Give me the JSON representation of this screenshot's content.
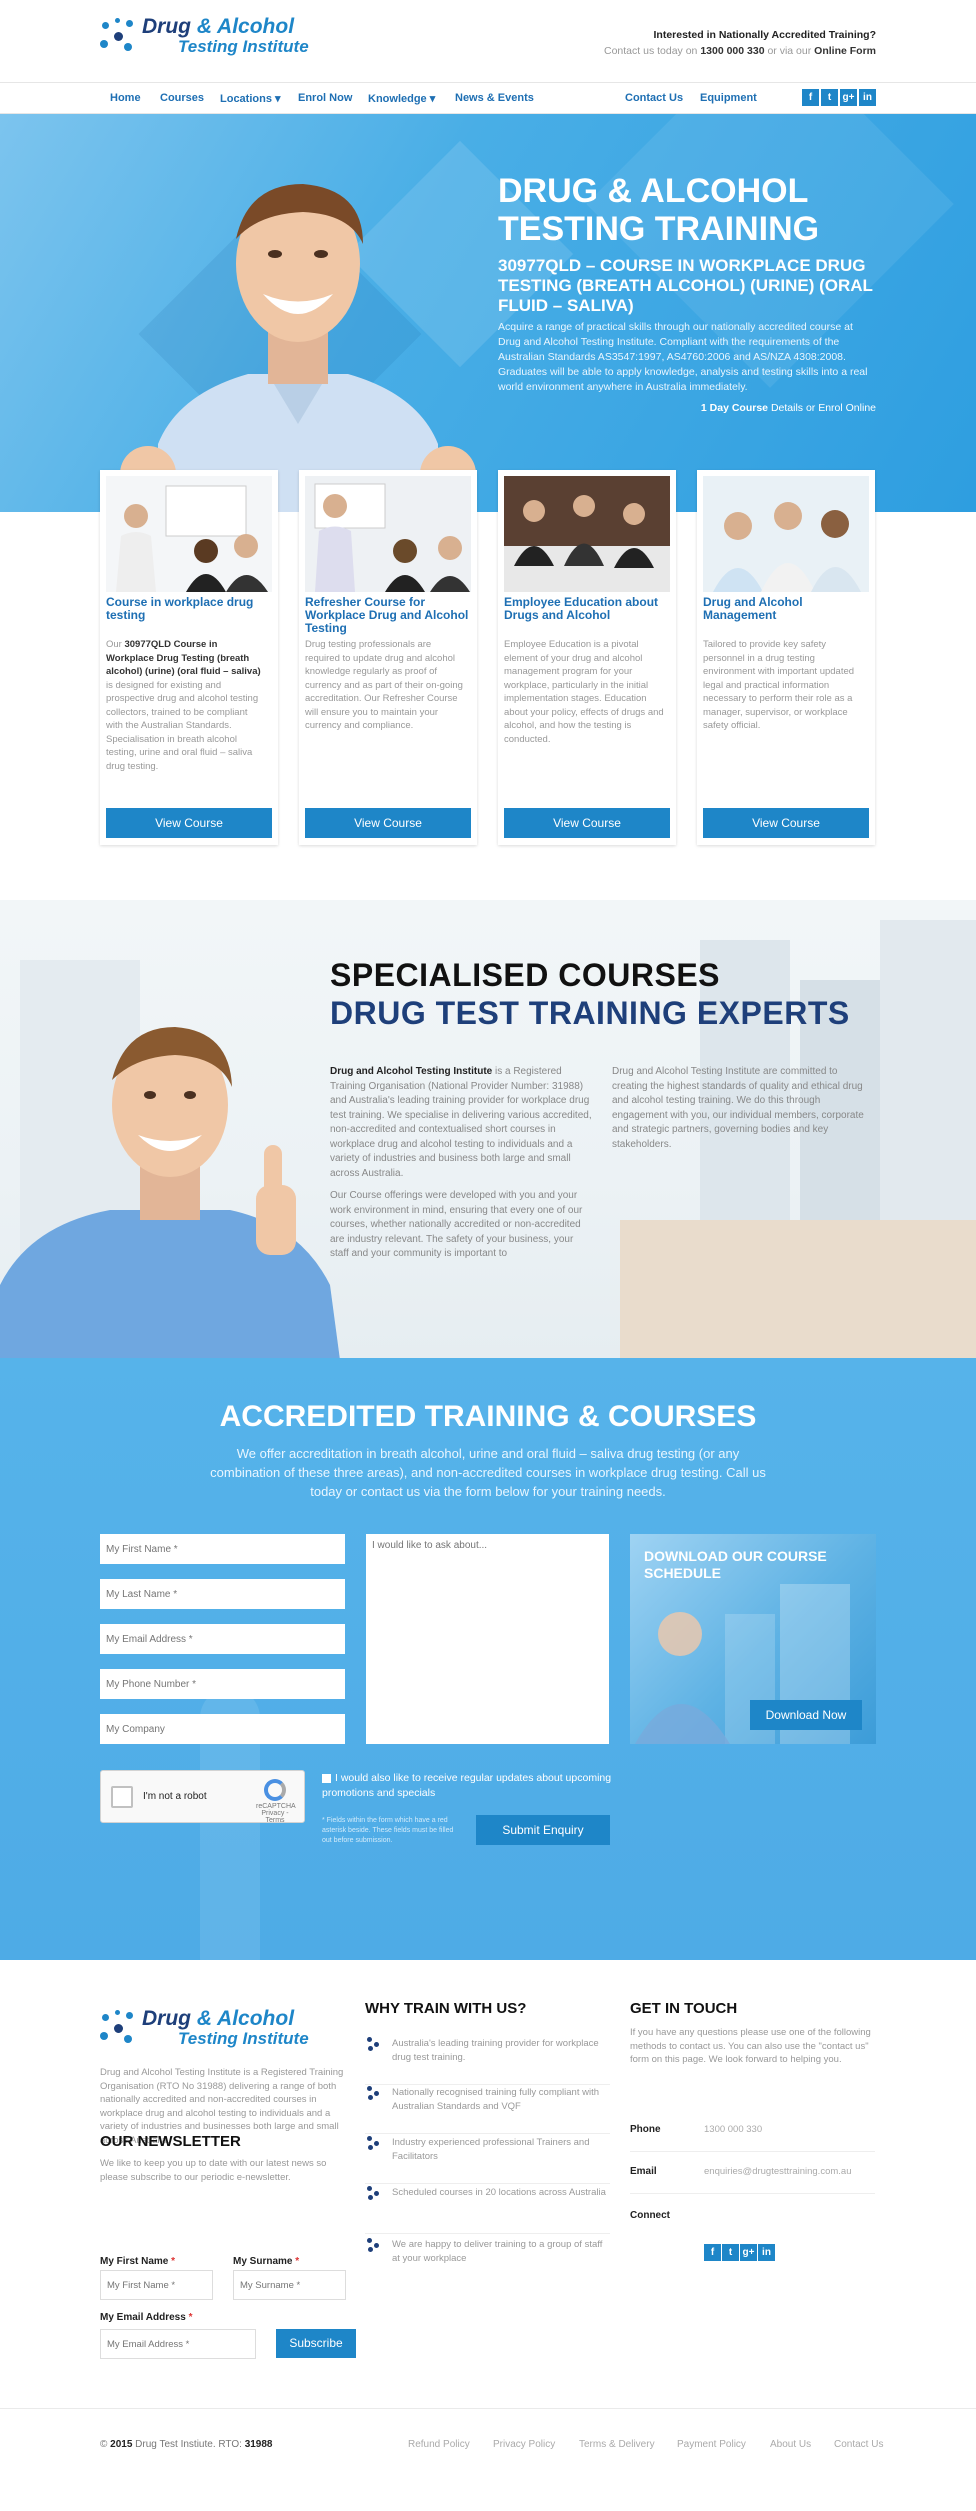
{
  "brand": {
    "line1_a": "Drug ",
    "line1_b": "& Alcohol",
    "line2": "Testing Institute",
    "primary": "#1e86c8",
    "dark": "#1e3f7a"
  },
  "header": {
    "question": "Interested in Nationally Accredited Training?",
    "contact_prefix": "Contact us today on ",
    "phone": "1300 000 330",
    "contact_mid": " or via our ",
    "form_link": "Online Form"
  },
  "nav": {
    "items": [
      "Home",
      "Courses",
      "Locations ▾",
      "Enrol Now",
      "Knowledge ▾",
      "News & Events"
    ],
    "right": [
      "Contact Us",
      "Equipment"
    ],
    "social": [
      "f",
      "t",
      "g+",
      "in"
    ]
  },
  "hero": {
    "title": "DRUG & ALCOHOL TESTING TRAINING",
    "subtitle": "30977QLD – COURSE IN WORKPLACE DRUG TESTING (BREATH ALCOHOL) (URINE) (ORAL FLUID – SALIVA)",
    "body": "Acquire a range of practical skills through our nationally accredited course at Drug and Alcohol Testing Institute. Compliant with the requirements of the Australian Standards AS3547:1997, AS4760:2006 and AS/NZA 4308:2008. Graduates will be able to apply knowledge, analysis and testing skills into a real world environment anywhere in Australia immediately.",
    "link_bold": "1 Day Course",
    "link_rest": " Details or Enrol Online"
  },
  "cards": [
    {
      "title": "Course in workplace drug testing",
      "text_pre": "Our ",
      "text_bold": "30977QLD Course in Workplace Drug Testing (breath alcohol) (urine) (oral fluid – saliva)",
      "text_post": " is designed for existing and prospective drug and alcohol testing collectors, trained to be compliant with the Australian Standards. Specialisation in breath alcohol testing, urine and oral fluid – saliva drug testing.",
      "button": "View Course"
    },
    {
      "title": "Refresher Course for Workplace Drug and Alcohol Testing",
      "text_pre": "Drug testing professionals are required to update drug and alcohol knowledge regularly as proof of currency and as part of their on-going accreditation. Our Refresher Course will ensure you to maintain your currency and compliance.",
      "text_bold": "",
      "text_post": "",
      "button": "View Course"
    },
    {
      "title": "Employee Education about Drugs and Alcohol",
      "text_pre": "Employee Education is a pivotal element of your drug and alcohol management program for your workplace, particularly in the initial implementation stages. Education about your policy, effects of drugs and alcohol, and how the testing is conducted.",
      "text_bold": "",
      "text_post": "",
      "button": "View Course"
    },
    {
      "title": "Drug and Alcohol Management",
      "text_pre": "Tailored to provide key safety personnel in a drug testing environment with important updated legal and practical information necessary to perform their role as a manager, supervisor, or workplace safety official.",
      "text_bold": "",
      "text_post": "",
      "button": "View Course"
    }
  ],
  "specialised": {
    "title1": "SPECIALISED COURSES",
    "title2": "DRUG TEST TRAINING EXPERTS",
    "col1_bold": "Drug and Alcohol Testing Institute",
    "col1_p1": " is a Registered Training Organisation (National Provider Number: 31988) and Australia's leading training provider for workplace drug test training. We specialise in delivering various accredited, non-accredited and contextualised short courses in workplace drug and alcohol testing to individuals and a variety of industries and business both large and small across Australia.",
    "col1_p2": "Our Course offerings were developed with you and your work environment in mind, ensuring that every one of our courses, whether nationally accredited or non-accredited are industry relevant. The safety of your business, your staff and your community is important to",
    "col2": "Drug and Alcohol Testing Institute are committed to creating the highest standards of quality and ethical drug and alcohol testing training. We do this through engagement with you, our individual members, corporate and strategic partners, governing bodies and key stakeholders."
  },
  "accredited": {
    "title": "ACCREDITED TRAINING & COURSES",
    "desc": "We offer accreditation in breath alcohol, urine and oral fluid – saliva drug testing (or any combination of these three areas), and non-accredited courses in workplace drug testing. Call us today or contact us via the form below for your training needs.",
    "fields": [
      "My First Name *",
      "My Last Name *",
      "My Email Address *",
      "My Phone Number *",
      "My Company"
    ],
    "message_placeholder": "I would like to ask about...",
    "download_title": "DOWNLOAD OUR COURSE SCHEDULE",
    "download_button": "Download Now",
    "captcha_label": "I'm not a robot",
    "captcha_brand": "reCAPTCHA",
    "captcha_terms": "Privacy - Terms",
    "updates": "I would also like to receive regular updates about upcoming promotions and specials",
    "note": "* Fields within the form which have a red asterisk beside. These fields must be filled out before submission.",
    "submit": "Submit Enquiry"
  },
  "footer": {
    "about": "Drug and Alcohol Testing Institute is a Registered Training Organisation (RTO No 31988) delivering a range of both nationally accredited and non-accredited courses in workplace drug and alcohol testing to individuals and a variety of industries and businesses both large and small across Australia.",
    "newsletter_title": "OUR NEWSLETTER",
    "newsletter_desc": "We like to keep you up to date with our latest news so please subscribe to our periodic e-newsletter.",
    "first_name_label": "My First Name",
    "surname_label": "My Surname",
    "email_label": "My Email Address",
    "first_name_ph": "My First Name *",
    "surname_ph": "My Surname *",
    "email_ph": "My Email Address *",
    "subscribe": "Subscribe",
    "why_title": "WHY TRAIN WITH US?",
    "why_items": [
      "Australia's leading training provider for workplace drug test training.",
      "Nationally recognised training fully compliant with Australian Standards and VQF",
      "Industry experienced professional Trainers and Facilitators",
      "Scheduled courses in 20 locations across Australia",
      "We are happy to deliver training to a group of staff at your workplace"
    ],
    "git_title": "GET IN TOUCH",
    "git_desc": "If you have any questions please use one of the following methods to contact us. You can also use the \"contact us\" form on this page. We look forward to helping you.",
    "phone_label": "Phone",
    "phone": "1300 000 330",
    "email_label_c": "Email",
    "email": "enquiries@drugtesttraining.com.au",
    "connect_label": "Connect"
  },
  "bottom": {
    "copy_pre": "© ",
    "year": "2015",
    "copy_mid": " Drug Test Instiute. RTO: ",
    "rto": "31988",
    "links": [
      "Refund Policy",
      "Privacy Policy",
      "Terms & Delivery",
      "Payment Policy",
      "About Us",
      "Contact Us"
    ]
  }
}
